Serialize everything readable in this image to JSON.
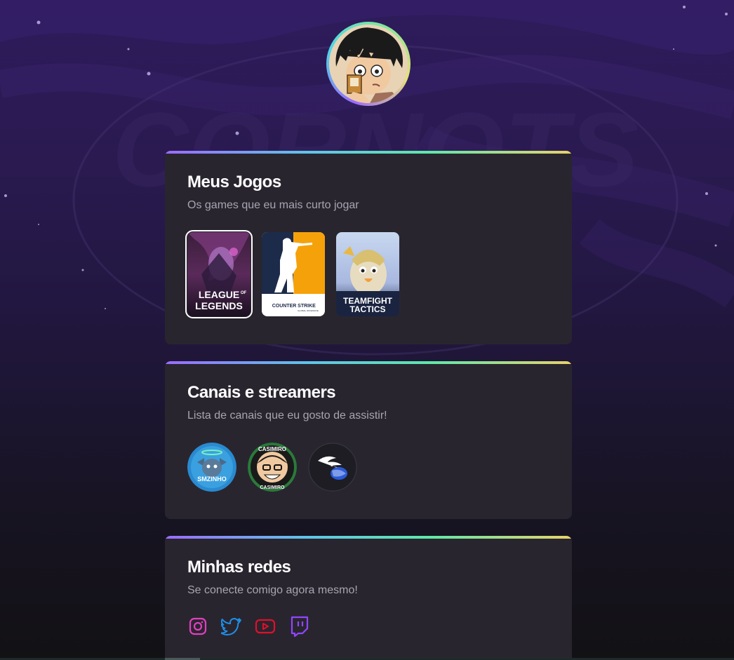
{
  "profile": {
    "avatar_icon": "avatar-anime-character"
  },
  "games_section": {
    "title": "Meus Jogos",
    "subtitle": "Os games que eu mais curto jogar",
    "games": [
      {
        "label_line1": "LEAGUE",
        "label_of": "OF",
        "label_line2": "LEGENDS",
        "selected": true
      },
      {
        "label_line1": "COUNTER",
        "label_line2": "STRIKE",
        "label_sub": "GLOBAL OFFENSIVE",
        "selected": false
      },
      {
        "label_line1": "TEAMFIGHT",
        "label_line2": "TACTICS",
        "selected": false
      }
    ]
  },
  "channels_section": {
    "title": "Canais e streamers",
    "subtitle": "Lista de canais que eu gosto de assistir!",
    "channels": [
      {
        "label": "SMZINHO"
      },
      {
        "label": "CASIMIRO",
        "label_bottom": "CASIMIRO"
      },
      {
        "icon": "wing-logo-icon"
      }
    ]
  },
  "socials_section": {
    "title": "Minhas redes",
    "subtitle": "Se conecte comigo agora mesmo!",
    "links": [
      {
        "icon": "instagram-icon",
        "color": "#e23fbf"
      },
      {
        "icon": "twitter-icon",
        "color": "#1d8fe8"
      },
      {
        "icon": "youtube-icon",
        "color": "#e0102a"
      },
      {
        "icon": "twitch-icon",
        "color": "#9146ff"
      }
    ]
  },
  "colors": {
    "card_bg": "#29252f",
    "accent_gradient": [
      "#9b6bff",
      "#5fc4e8",
      "#5ee8a8",
      "#e8d36a"
    ],
    "subtitle": "#a8a5b0"
  }
}
